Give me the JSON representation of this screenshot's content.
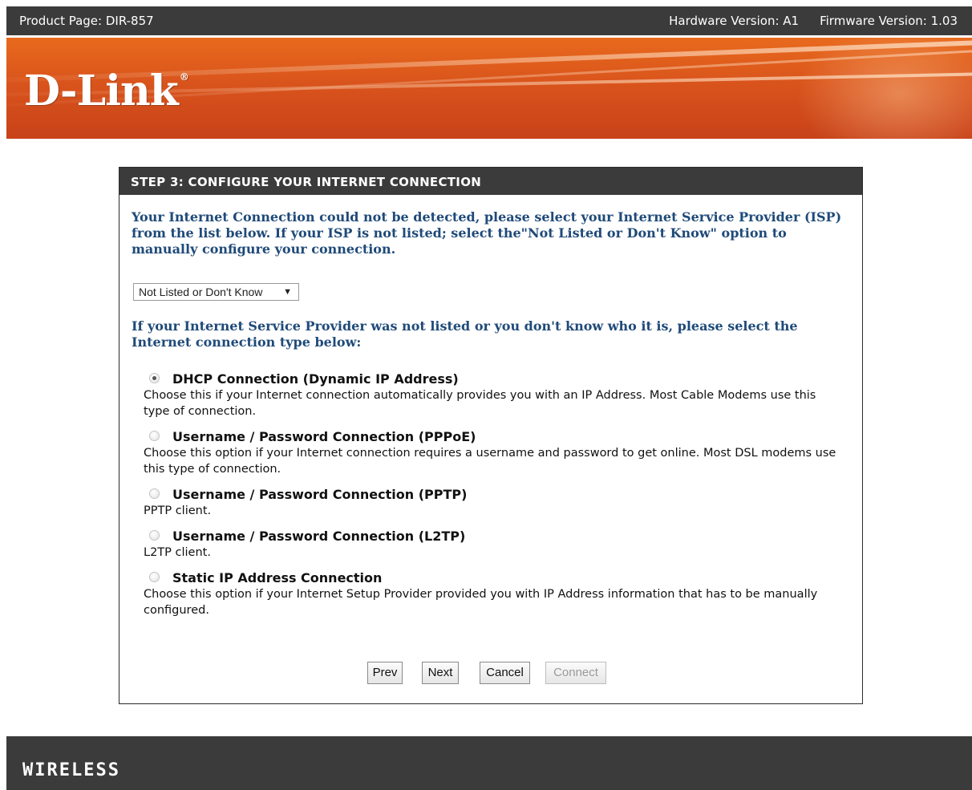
{
  "topbar": {
    "product": "Product Page: DIR-857",
    "hardware": "Hardware Version: A1",
    "firmware": "Firmware Version: 1.03"
  },
  "banner": {
    "logo": "D-Link",
    "logo_mark": "®"
  },
  "step": {
    "title": "STEP 3: CONFIGURE YOUR INTERNET CONNECTION",
    "intro": "Your Internet Connection could not be detected, please select your Internet Service Provider (ISP) from the list below. If your ISP is not listed; select the\"Not Listed or Don't Know\" option to manually configure your connection.",
    "isp_select": {
      "selected": "Not Listed or Don't Know",
      "arrow": "▼"
    },
    "intro2": "If your Internet Service Provider was not listed or you don't know who it is, please select the Internet connection type below:",
    "options": [
      {
        "label": "DHCP Connection (Dynamic IP Address)",
        "desc": "Choose this if your Internet connection automatically provides you with an IP Address. Most Cable Modems use this type of connection.",
        "checked": true
      },
      {
        "label": "Username / Password Connection (PPPoE)",
        "desc": "Choose this option if your Internet connection requires a username and password to get online. Most DSL modems use this type of connection.",
        "checked": false
      },
      {
        "label": "Username / Password Connection (PPTP)",
        "desc": "PPTP client.",
        "checked": false
      },
      {
        "label": "Username / Password Connection (L2TP)",
        "desc": "L2TP client.",
        "checked": false
      },
      {
        "label": "Static IP Address Connection",
        "desc": "Choose this option if your Internet Setup Provider provided you with IP Address information that has to be manually configured.",
        "checked": false
      }
    ],
    "buttons": {
      "prev": "Prev",
      "next": "Next",
      "cancel": "Cancel",
      "connect": "Connect"
    }
  },
  "footer": {
    "brand": "WIRELESS"
  },
  "colors": {
    "banner": "#d9541c",
    "dark": "#3b3b3b",
    "heading_blue": "#1f4a79"
  }
}
